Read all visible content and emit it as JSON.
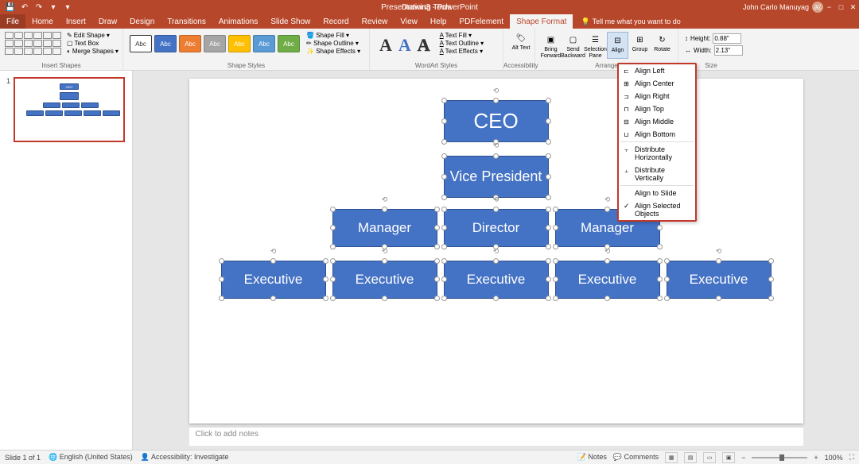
{
  "titlebar": {
    "title": "Presentation3 - PowerPoint",
    "tool_context": "Drawing Tools",
    "user": "John Carlo Manuyag",
    "avatar_initials": "JC"
  },
  "tabs": {
    "file": "File",
    "items": [
      "Home",
      "Insert",
      "Draw",
      "Design",
      "Transitions",
      "Animations",
      "Slide Show",
      "Record",
      "Review",
      "View",
      "Help",
      "PDFelement"
    ],
    "active": "Shape Format",
    "tell_me": "Tell me what you want to do"
  },
  "ribbon": {
    "insert_shapes": {
      "label": "Insert Shapes",
      "edit_shape": "Edit Shape",
      "text_box": "Text Box",
      "merge": "Merge Shapes"
    },
    "shape_styles": {
      "label": "Shape Styles",
      "swatch_text": "Abc",
      "fill": "Shape Fill",
      "outline": "Shape Outline",
      "effects": "Shape Effects"
    },
    "wordart": {
      "label": "WordArt Styles",
      "text_fill": "Text Fill",
      "text_outline": "Text Outline",
      "text_effects": "Text Effects"
    },
    "accessibility": {
      "label": "Accessibility",
      "alt_text": "Alt Text"
    },
    "arrange": {
      "label": "Arrange",
      "bring_forward": "Bring Forward",
      "send_backward": "Send Backward",
      "selection_pane": "Selection Pane",
      "align": "Align",
      "group": "Group",
      "rotate": "Rotate"
    },
    "size": {
      "label": "Size",
      "height_label": "Height:",
      "height": "0.88\"",
      "width_label": "Width:",
      "width": "2.13\""
    }
  },
  "align_menu": {
    "left": "Align Left",
    "center": "Align Center",
    "right": "Align Right",
    "top": "Align Top",
    "middle": "Align Middle",
    "bottom": "Align Bottom",
    "dist_h": "Distribute Horizontally",
    "dist_v": "Distribute Vertically",
    "to_slide": "Align to Slide",
    "selected": "Align Selected Objects"
  },
  "slide": {
    "ceo": "CEO",
    "vp": "Vice President",
    "manager": "Manager",
    "director": "Director",
    "executive": "Executive"
  },
  "notes": {
    "placeholder": "Click to add notes"
  },
  "status": {
    "slide_info": "Slide 1 of 1",
    "language": "English (United States)",
    "accessibility": "Accessibility: Investigate",
    "notes": "Notes",
    "comments": "Comments",
    "zoom": "100%"
  },
  "colors": {
    "swatches": [
      "#ffffff",
      "#4472c4",
      "#ed7d31",
      "#a5a5a5",
      "#ffc000",
      "#5b9bd5",
      "#70ad47"
    ],
    "wa": [
      "#333333",
      "#4472c4",
      "#333333"
    ]
  }
}
